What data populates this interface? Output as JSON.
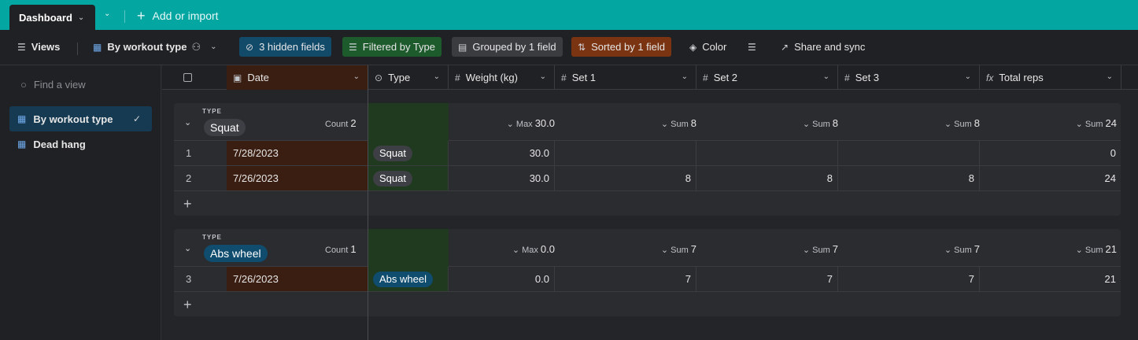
{
  "topbar": {
    "tab_label": "Dashboard",
    "add_import": "Add or import",
    "bg_color": "#03a6a1"
  },
  "toolbar": {
    "views": "Views",
    "current_view": "By workout type",
    "hidden_fields": "3 hidden fields",
    "filtered": "Filtered by Type",
    "grouped": "Grouped by 1 field",
    "sorted": "Sorted by 1 field",
    "color": "Color",
    "share": "Share and sync"
  },
  "sidebar": {
    "find_placeholder": "Find a view",
    "items": [
      {
        "label": "By workout type",
        "active": true
      },
      {
        "label": "Dead hang",
        "active": false
      }
    ]
  },
  "columns": [
    {
      "label": "Date",
      "icon": "calendar-icon"
    },
    {
      "label": "Type",
      "icon": "single-select-icon"
    },
    {
      "label": "Weight (kg)",
      "icon": "number-icon"
    },
    {
      "label": "Set 1",
      "icon": "number-icon"
    },
    {
      "label": "Set 2",
      "icon": "number-icon"
    },
    {
      "label": "Set 3",
      "icon": "number-icon"
    },
    {
      "label": "Total reps",
      "icon": "formula-icon"
    }
  ],
  "groups": [
    {
      "type_label": "TYPE",
      "name": "Squat",
      "pill_color": "#3d3f44",
      "count_label": "Count",
      "count": "2",
      "aggregates": {
        "weight": {
          "label": "Max",
          "value": "30.0"
        },
        "set1": {
          "label": "Sum",
          "value": "8"
        },
        "set2": {
          "label": "Sum",
          "value": "8"
        },
        "set3": {
          "label": "Sum",
          "value": "8"
        },
        "total": {
          "label": "Sum",
          "value": "24"
        }
      },
      "rows": [
        {
          "num": "1",
          "date": "7/28/2023",
          "type": "Squat",
          "weight": "30.0",
          "set1": "",
          "set2": "",
          "set3": "",
          "total": "0"
        },
        {
          "num": "2",
          "date": "7/26/2023",
          "type": "Squat",
          "weight": "30.0",
          "set1": "8",
          "set2": "8",
          "set3": "8",
          "total": "24"
        }
      ]
    },
    {
      "type_label": "TYPE",
      "name": "Abs wheel",
      "pill_color": "#0f4c6e",
      "count_label": "Count",
      "count": "1",
      "aggregates": {
        "weight": {
          "label": "Max",
          "value": "0.0"
        },
        "set1": {
          "label": "Sum",
          "value": "7"
        },
        "set2": {
          "label": "Sum",
          "value": "7"
        },
        "set3": {
          "label": "Sum",
          "value": "7"
        },
        "total": {
          "label": "Sum",
          "value": "21"
        }
      },
      "rows": [
        {
          "num": "3",
          "date": "7/26/2023",
          "type": "Abs wheel",
          "weight": "0.0",
          "set1": "7",
          "set2": "7",
          "set3": "7",
          "total": "21"
        }
      ]
    }
  ]
}
